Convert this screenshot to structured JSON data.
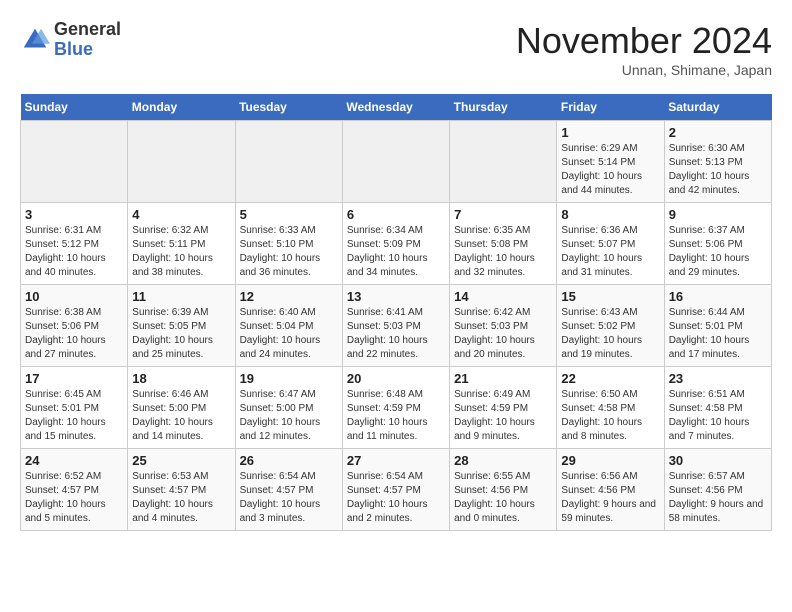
{
  "header": {
    "logo_general": "General",
    "logo_blue": "Blue",
    "month_title": "November 2024",
    "location": "Unnan, Shimane, Japan"
  },
  "calendar": {
    "days_of_week": [
      "Sunday",
      "Monday",
      "Tuesday",
      "Wednesday",
      "Thursday",
      "Friday",
      "Saturday"
    ],
    "weeks": [
      [
        {
          "day": "",
          "sunrise": "",
          "sunset": "",
          "daylight": ""
        },
        {
          "day": "",
          "sunrise": "",
          "sunset": "",
          "daylight": ""
        },
        {
          "day": "",
          "sunrise": "",
          "sunset": "",
          "daylight": ""
        },
        {
          "day": "",
          "sunrise": "",
          "sunset": "",
          "daylight": ""
        },
        {
          "day": "",
          "sunrise": "",
          "sunset": "",
          "daylight": ""
        },
        {
          "day": "1",
          "sunrise": "Sunrise: 6:29 AM",
          "sunset": "Sunset: 5:14 PM",
          "daylight": "Daylight: 10 hours and 44 minutes."
        },
        {
          "day": "2",
          "sunrise": "Sunrise: 6:30 AM",
          "sunset": "Sunset: 5:13 PM",
          "daylight": "Daylight: 10 hours and 42 minutes."
        }
      ],
      [
        {
          "day": "3",
          "sunrise": "Sunrise: 6:31 AM",
          "sunset": "Sunset: 5:12 PM",
          "daylight": "Daylight: 10 hours and 40 minutes."
        },
        {
          "day": "4",
          "sunrise": "Sunrise: 6:32 AM",
          "sunset": "Sunset: 5:11 PM",
          "daylight": "Daylight: 10 hours and 38 minutes."
        },
        {
          "day": "5",
          "sunrise": "Sunrise: 6:33 AM",
          "sunset": "Sunset: 5:10 PM",
          "daylight": "Daylight: 10 hours and 36 minutes."
        },
        {
          "day": "6",
          "sunrise": "Sunrise: 6:34 AM",
          "sunset": "Sunset: 5:09 PM",
          "daylight": "Daylight: 10 hours and 34 minutes."
        },
        {
          "day": "7",
          "sunrise": "Sunrise: 6:35 AM",
          "sunset": "Sunset: 5:08 PM",
          "daylight": "Daylight: 10 hours and 32 minutes."
        },
        {
          "day": "8",
          "sunrise": "Sunrise: 6:36 AM",
          "sunset": "Sunset: 5:07 PM",
          "daylight": "Daylight: 10 hours and 31 minutes."
        },
        {
          "day": "9",
          "sunrise": "Sunrise: 6:37 AM",
          "sunset": "Sunset: 5:06 PM",
          "daylight": "Daylight: 10 hours and 29 minutes."
        }
      ],
      [
        {
          "day": "10",
          "sunrise": "Sunrise: 6:38 AM",
          "sunset": "Sunset: 5:06 PM",
          "daylight": "Daylight: 10 hours and 27 minutes."
        },
        {
          "day": "11",
          "sunrise": "Sunrise: 6:39 AM",
          "sunset": "Sunset: 5:05 PM",
          "daylight": "Daylight: 10 hours and 25 minutes."
        },
        {
          "day": "12",
          "sunrise": "Sunrise: 6:40 AM",
          "sunset": "Sunset: 5:04 PM",
          "daylight": "Daylight: 10 hours and 24 minutes."
        },
        {
          "day": "13",
          "sunrise": "Sunrise: 6:41 AM",
          "sunset": "Sunset: 5:03 PM",
          "daylight": "Daylight: 10 hours and 22 minutes."
        },
        {
          "day": "14",
          "sunrise": "Sunrise: 6:42 AM",
          "sunset": "Sunset: 5:03 PM",
          "daylight": "Daylight: 10 hours and 20 minutes."
        },
        {
          "day": "15",
          "sunrise": "Sunrise: 6:43 AM",
          "sunset": "Sunset: 5:02 PM",
          "daylight": "Daylight: 10 hours and 19 minutes."
        },
        {
          "day": "16",
          "sunrise": "Sunrise: 6:44 AM",
          "sunset": "Sunset: 5:01 PM",
          "daylight": "Daylight: 10 hours and 17 minutes."
        }
      ],
      [
        {
          "day": "17",
          "sunrise": "Sunrise: 6:45 AM",
          "sunset": "Sunset: 5:01 PM",
          "daylight": "Daylight: 10 hours and 15 minutes."
        },
        {
          "day": "18",
          "sunrise": "Sunrise: 6:46 AM",
          "sunset": "Sunset: 5:00 PM",
          "daylight": "Daylight: 10 hours and 14 minutes."
        },
        {
          "day": "19",
          "sunrise": "Sunrise: 6:47 AM",
          "sunset": "Sunset: 5:00 PM",
          "daylight": "Daylight: 10 hours and 12 minutes."
        },
        {
          "day": "20",
          "sunrise": "Sunrise: 6:48 AM",
          "sunset": "Sunset: 4:59 PM",
          "daylight": "Daylight: 10 hours and 11 minutes."
        },
        {
          "day": "21",
          "sunrise": "Sunrise: 6:49 AM",
          "sunset": "Sunset: 4:59 PM",
          "daylight": "Daylight: 10 hours and 9 minutes."
        },
        {
          "day": "22",
          "sunrise": "Sunrise: 6:50 AM",
          "sunset": "Sunset: 4:58 PM",
          "daylight": "Daylight: 10 hours and 8 minutes."
        },
        {
          "day": "23",
          "sunrise": "Sunrise: 6:51 AM",
          "sunset": "Sunset: 4:58 PM",
          "daylight": "Daylight: 10 hours and 7 minutes."
        }
      ],
      [
        {
          "day": "24",
          "sunrise": "Sunrise: 6:52 AM",
          "sunset": "Sunset: 4:57 PM",
          "daylight": "Daylight: 10 hours and 5 minutes."
        },
        {
          "day": "25",
          "sunrise": "Sunrise: 6:53 AM",
          "sunset": "Sunset: 4:57 PM",
          "daylight": "Daylight: 10 hours and 4 minutes."
        },
        {
          "day": "26",
          "sunrise": "Sunrise: 6:54 AM",
          "sunset": "Sunset: 4:57 PM",
          "daylight": "Daylight: 10 hours and 3 minutes."
        },
        {
          "day": "27",
          "sunrise": "Sunrise: 6:54 AM",
          "sunset": "Sunset: 4:57 PM",
          "daylight": "Daylight: 10 hours and 2 minutes."
        },
        {
          "day": "28",
          "sunrise": "Sunrise: 6:55 AM",
          "sunset": "Sunset: 4:56 PM",
          "daylight": "Daylight: 10 hours and 0 minutes."
        },
        {
          "day": "29",
          "sunrise": "Sunrise: 6:56 AM",
          "sunset": "Sunset: 4:56 PM",
          "daylight": "Daylight: 9 hours and 59 minutes."
        },
        {
          "day": "30",
          "sunrise": "Sunrise: 6:57 AM",
          "sunset": "Sunset: 4:56 PM",
          "daylight": "Daylight: 9 hours and 58 minutes."
        }
      ]
    ]
  }
}
